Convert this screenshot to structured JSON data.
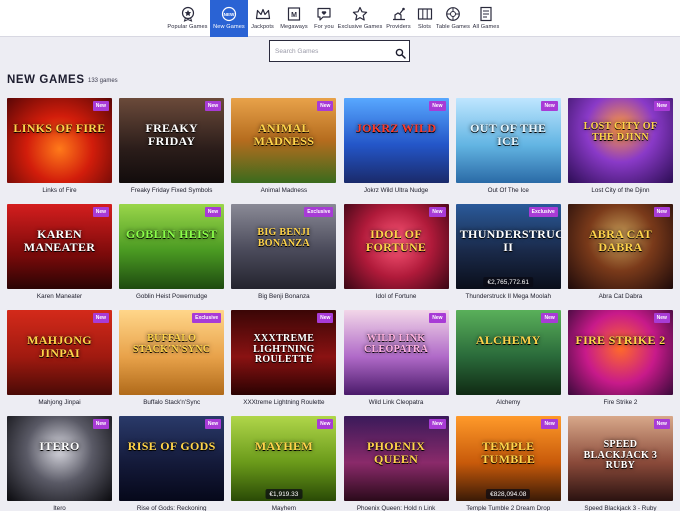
{
  "nav": {
    "items": [
      {
        "label": "Popular Games",
        "icon": "star-badge-icon",
        "active": false
      },
      {
        "label": "New Games",
        "icon": "new-badge-icon",
        "active": true
      },
      {
        "label": "Jackpots",
        "icon": "crown-icon",
        "active": false
      },
      {
        "label": "Megaways",
        "icon": "megaways-icon",
        "active": false
      },
      {
        "label": "For you",
        "icon": "heart-chat-icon",
        "active": false
      },
      {
        "label": "Exclusive Games",
        "icon": "star-outline-icon",
        "active": false
      },
      {
        "label": "Providers",
        "icon": "providers-icon",
        "active": false
      },
      {
        "label": "Slots",
        "icon": "slots-icon",
        "active": false
      },
      {
        "label": "Table Games",
        "icon": "roulette-icon",
        "active": false
      },
      {
        "label": "All Games",
        "icon": "all-games-icon",
        "active": false
      }
    ]
  },
  "search": {
    "placeholder": "Search Games",
    "icon": "search-icon"
  },
  "section": {
    "title": "NEW GAMES",
    "count": "133 games"
  },
  "colors": {
    "accent": "#2a63d4",
    "badge": "#a83bd6",
    "background": "#ededf3"
  },
  "games": [
    {
      "name": "Links of Fire",
      "badge": "New",
      "logo": "Links of Fire",
      "jackpot": ""
    },
    {
      "name": "Freaky Friday Fixed Symbols",
      "badge": "New",
      "logo": "Freaky Friday",
      "jackpot": ""
    },
    {
      "name": "Animal Madness",
      "badge": "New",
      "logo": "Animal Madness",
      "jackpot": ""
    },
    {
      "name": "Jokrz Wild Ultra Nudge",
      "badge": "New",
      "logo": "Jokrz Wild",
      "jackpot": ""
    },
    {
      "name": "Out Of The Ice",
      "badge": "New",
      "logo": "Out of the Ice",
      "jackpot": ""
    },
    {
      "name": "Lost City of the Djinn",
      "badge": "New",
      "logo": "Lost City of the Djinn",
      "jackpot": ""
    },
    {
      "name": "Karen Maneater",
      "badge": "New",
      "logo": "Karen Maneater",
      "jackpot": ""
    },
    {
      "name": "Goblin Heist Powernudge",
      "badge": "New",
      "logo": "Goblin Heist",
      "jackpot": ""
    },
    {
      "name": "Big Benji Bonanza",
      "badge": "Exclusive",
      "logo": "Big Benji Bonanza",
      "jackpot": ""
    },
    {
      "name": "Idol of Fortune",
      "badge": "New",
      "logo": "Idol of Fortune",
      "jackpot": ""
    },
    {
      "name": "Thunderstruck II Mega Moolah",
      "badge": "Exclusive",
      "logo": "Thunderstruck II",
      "jackpot": "€2,765,772.61"
    },
    {
      "name": "Abra Cat Dabra",
      "badge": "New",
      "logo": "Abra Cat Dabra",
      "jackpot": ""
    },
    {
      "name": "Mahjong Jinpai",
      "badge": "New",
      "logo": "Mahjong Jinpai",
      "jackpot": ""
    },
    {
      "name": "Buffalo Stack'n'Sync",
      "badge": "Exclusive",
      "logo": "Buffalo Stack'n'Sync",
      "jackpot": ""
    },
    {
      "name": "XXXtreme Lightning Roulette",
      "badge": "New",
      "logo": "XXXtreme Lightning Roulette",
      "jackpot": ""
    },
    {
      "name": "Wild Link Cleopatra",
      "badge": "New",
      "logo": "Wild Link Cleopatra",
      "jackpot": ""
    },
    {
      "name": "Alchemy",
      "badge": "New",
      "logo": "Alchemy",
      "jackpot": ""
    },
    {
      "name": "Fire Strike 2",
      "badge": "New",
      "logo": "Fire Strike 2",
      "jackpot": ""
    },
    {
      "name": "Itero",
      "badge": "New",
      "logo": "Itero",
      "jackpot": ""
    },
    {
      "name": "Rise of Gods: Reckoning",
      "badge": "New",
      "logo": "Rise of Gods",
      "jackpot": ""
    },
    {
      "name": "Mayhem",
      "badge": "New",
      "logo": "Mayhem",
      "jackpot": "€1,919.33"
    },
    {
      "name": "Phoenix Queen: Hold n Link",
      "badge": "New",
      "logo": "Phoenix Queen",
      "jackpot": ""
    },
    {
      "name": "Temple Tumble 2 Dream Drop",
      "badge": "New",
      "logo": "Temple Tumble",
      "jackpot": "€828,094.08"
    },
    {
      "name": "Speed Blackjack 3 - Ruby",
      "badge": "New",
      "logo": "Speed Blackjack 3 Ruby",
      "jackpot": ""
    }
  ]
}
